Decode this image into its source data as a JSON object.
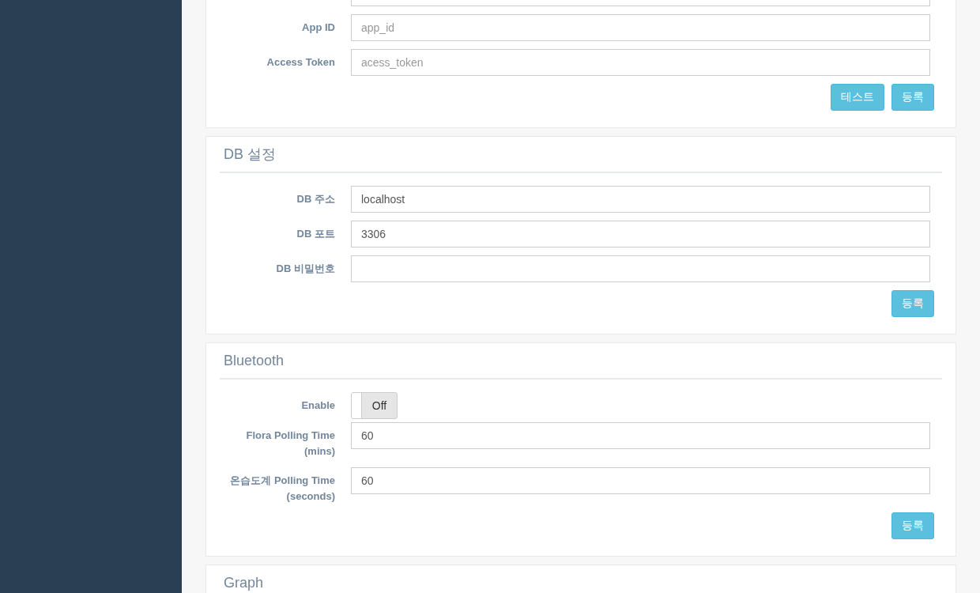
{
  "panels": [
    {
      "rows": [
        {
          "kind": "text",
          "label": "App ID",
          "placeholder": "app_id"
        },
        {
          "kind": "text",
          "label": "Access Token",
          "placeholder": "acess_token"
        }
      ],
      "buttons": [
        "테스트",
        "등록"
      ]
    },
    {
      "title": "DB 설정",
      "rows": [
        {
          "kind": "text",
          "label": "DB 주소",
          "value": "localhost"
        },
        {
          "kind": "text",
          "label": "DB 포트",
          "value": "3306"
        },
        {
          "kind": "text",
          "label": "DB 비밀번호",
          "value": ""
        }
      ],
      "buttons": [
        "등록"
      ]
    },
    {
      "title": "Bluetooth",
      "rows": [
        {
          "kind": "toggle",
          "label": "Enable",
          "on": false,
          "off_text": "Off"
        },
        {
          "kind": "text",
          "label": "Flora Polling Time (mins)",
          "value": "60"
        },
        {
          "kind": "text",
          "label": "온습도계 Polling Time (seconds)",
          "value": "60"
        }
      ],
      "buttons": [
        "등록"
      ]
    },
    {
      "title": "Graph"
    }
  ]
}
